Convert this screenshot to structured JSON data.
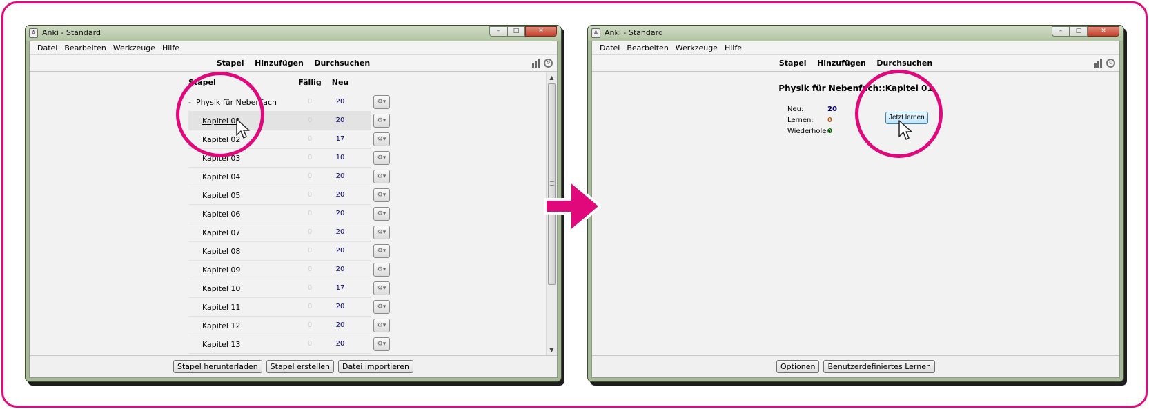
{
  "left_window": {
    "title": "Anki - Standard",
    "menu": [
      "Datei",
      "Bearbeiten",
      "Werkzeuge",
      "Hilfe"
    ],
    "toolbar": [
      "Stapel",
      "Hinzufügen",
      "Durchsuchen"
    ],
    "columns": {
      "deck": "Stapel",
      "due": "Fällig",
      "new": "Neu"
    },
    "parent_deck": {
      "toggle": "-",
      "name": "Physik für Nebenfach",
      "due": "0",
      "new": "20"
    },
    "decks": [
      {
        "name": "Kapitel 01",
        "due": "0",
        "new": "20"
      },
      {
        "name": "Kapitel 02",
        "due": "0",
        "new": "17"
      },
      {
        "name": "Kapitel 03",
        "due": "0",
        "new": "10"
      },
      {
        "name": "Kapitel 04",
        "due": "0",
        "new": "20"
      },
      {
        "name": "Kapitel 05",
        "due": "0",
        "new": "20"
      },
      {
        "name": "Kapitel 06",
        "due": "0",
        "new": "20"
      },
      {
        "name": "Kapitel 07",
        "due": "0",
        "new": "20"
      },
      {
        "name": "Kapitel 08",
        "due": "0",
        "new": "20"
      },
      {
        "name": "Kapitel 09",
        "due": "0",
        "new": "20"
      },
      {
        "name": "Kapitel 10",
        "due": "0",
        "new": "17"
      },
      {
        "name": "Kapitel 11",
        "due": "0",
        "new": "20"
      },
      {
        "name": "Kapitel 12",
        "due": "0",
        "new": "20"
      },
      {
        "name": "Kapitel 13",
        "due": "0",
        "new": "20"
      }
    ],
    "bottom_buttons": [
      "Stapel herunterladen",
      "Stapel erstellen",
      "Datei importieren"
    ]
  },
  "right_window": {
    "title": "Anki - Standard",
    "menu": [
      "Datei",
      "Bearbeiten",
      "Werkzeuge",
      "Hilfe"
    ],
    "toolbar": [
      "Stapel",
      "Hinzufügen",
      "Durchsuchen"
    ],
    "deck_title": "Physik für Nebenfach::Kapitel 01",
    "stats": [
      {
        "label": "Neu:",
        "value": "20",
        "color": "#000080"
      },
      {
        "label": "Lernen:",
        "value": "0",
        "color": "#c35617"
      },
      {
        "label": "Wiederholen:",
        "value": "0",
        "color": "#007700"
      }
    ],
    "study_button": "Jetzt lernen",
    "bottom_buttons": [
      "Optionen",
      "Benutzerdefiniertes Lernen"
    ]
  },
  "colors": {
    "accent": "#e0087a"
  },
  "icons": {
    "stats": "stats-icon",
    "sync": "sync-icon",
    "gear": "gear-icon"
  }
}
